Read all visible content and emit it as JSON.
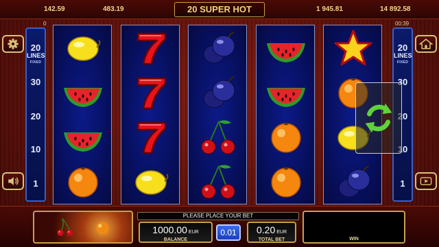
{
  "jackpots": {
    "jp1": "142.59",
    "jp2": "483.19",
    "jp3": "1 945.81",
    "jp4": "14 892.58"
  },
  "title": "20 SUPER HOT",
  "left_counter": "0",
  "timer": "00:39",
  "lines_panel": {
    "lines_count": "20",
    "lines_label": "LINES",
    "fixed_label": "FIXED",
    "markers": [
      "30",
      "20",
      "10",
      "1"
    ]
  },
  "reels": [
    [
      "lemon",
      "watermelon",
      "watermelon",
      "orange"
    ],
    [
      "seven",
      "seven",
      "seven",
      "lemon"
    ],
    [
      "plum",
      "plum",
      "cherries",
      "cherries"
    ],
    [
      "watermelon",
      "watermelon",
      "orange",
      "orange"
    ],
    [
      "star",
      "orange",
      "lemon",
      "plum"
    ]
  ],
  "icons": {
    "settings": "gear-icon",
    "sound": "speaker-icon",
    "home": "home-icon",
    "history": "history-icon",
    "spin": "spin-arrows-icon"
  },
  "message": "PLEASE PLACE YOUR BET",
  "balance": {
    "value": "1000.00",
    "currency": "EUR",
    "label": "BALANCE"
  },
  "denomination": "0.01",
  "total_bet": {
    "value": "0.20",
    "currency": "EUR",
    "label": "TOTAL BET"
  },
  "win": {
    "label": "WIN"
  },
  "colors": {
    "accent_gold": "#c9a14a",
    "reel_blue": "#071060",
    "bg_red": "#5a0e08"
  }
}
